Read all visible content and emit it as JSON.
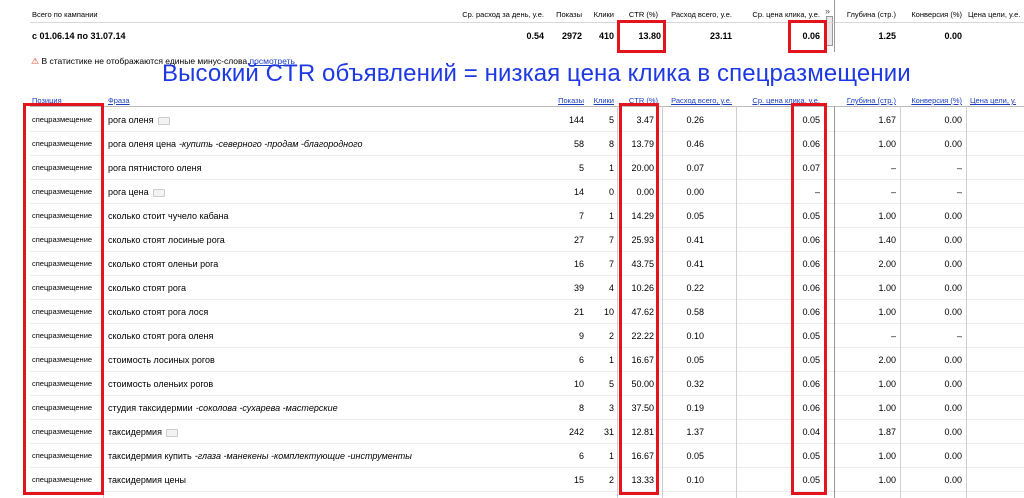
{
  "summary": {
    "label": "Всего по кампании",
    "period": "с 01.06.14 по 31.07.14",
    "headers": {
      "avg_daily": "Ср. расход за день, у.е.",
      "impressions": "Показы",
      "clicks": "Клики",
      "ctr": "CTR (%)",
      "total_cost": "Расход всего, у.е.",
      "avg_cpc": "Ср. цена клика, у.е.",
      "depth": "Глубина (стр.)",
      "conversion": "Конверсия (%)",
      "goal_cost": "Цена цели, у.е."
    },
    "values": {
      "avg_daily": "0.54",
      "impressions": "2972",
      "clicks": "410",
      "ctr": "13.80",
      "total_cost": "23.11",
      "avg_cpc": "0.06",
      "depth": "1.25",
      "conversion": "0.00"
    }
  },
  "warning": {
    "text": "В статистике не отображаются единые минус-слова",
    "link": "посмотреть"
  },
  "annotation": "Высокий CTR объявлений = низкая цена клика в спецразмещении",
  "table": {
    "headers": {
      "position": "Позиция",
      "phrase": "Фраза",
      "impressions": "Показы",
      "clicks": "Клики",
      "ctr": "CTR (%)",
      "total_cost": "Расход всего, у.е.",
      "avg_cpc": "Ср. цена клика, у.е.",
      "depth": "Глубина (стр.)",
      "conversion": "Конверсия (%)",
      "goal_cost": "Цена цели, у."
    },
    "rows": [
      {
        "position": "спецразмещение",
        "phrase": "рога оленя",
        "minus": "",
        "dots": true,
        "impressions": "144",
        "clicks": "5",
        "ctr": "3.47",
        "total_cost": "0.26",
        "avg_cpc": "0.05",
        "depth": "1.67",
        "conversion": "0.00"
      },
      {
        "position": "спецразмещение",
        "phrase": "рога оленя цена",
        "minus": "-купить -северного -продам -благородного",
        "dots": false,
        "impressions": "58",
        "clicks": "8",
        "ctr": "13.79",
        "total_cost": "0.46",
        "avg_cpc": "0.06",
        "depth": "1.00",
        "conversion": "0.00"
      },
      {
        "position": "спецразмещение",
        "phrase": "рога пятнистого оленя",
        "minus": "",
        "dots": false,
        "impressions": "5",
        "clicks": "1",
        "ctr": "20.00",
        "total_cost": "0.07",
        "avg_cpc": "0.07",
        "depth": "–",
        "conversion": "–"
      },
      {
        "position": "спецразмещение",
        "phrase": "рога цена",
        "minus": "",
        "dots": true,
        "impressions": "14",
        "clicks": "0",
        "ctr": "0.00",
        "total_cost": "0.00",
        "avg_cpc": "–",
        "depth": "–",
        "conversion": "–"
      },
      {
        "position": "спецразмещение",
        "phrase": "сколько стоит чучело кабана",
        "minus": "",
        "dots": false,
        "impressions": "7",
        "clicks": "1",
        "ctr": "14.29",
        "total_cost": "0.05",
        "avg_cpc": "0.05",
        "depth": "1.00",
        "conversion": "0.00"
      },
      {
        "position": "спецразмещение",
        "phrase": "сколько стоят лосиные рога",
        "minus": "",
        "dots": false,
        "impressions": "27",
        "clicks": "7",
        "ctr": "25.93",
        "total_cost": "0.41",
        "avg_cpc": "0.06",
        "depth": "1.40",
        "conversion": "0.00"
      },
      {
        "position": "спецразмещение",
        "phrase": "сколько стоят оленьи рога",
        "minus": "",
        "dots": false,
        "impressions": "16",
        "clicks": "7",
        "ctr": "43.75",
        "total_cost": "0.41",
        "avg_cpc": "0.06",
        "depth": "2.00",
        "conversion": "0.00"
      },
      {
        "position": "спецразмещение",
        "phrase": "сколько стоят рога",
        "minus": "",
        "dots": false,
        "impressions": "39",
        "clicks": "4",
        "ctr": "10.26",
        "total_cost": "0.22",
        "avg_cpc": "0.06",
        "depth": "1.00",
        "conversion": "0.00"
      },
      {
        "position": "спецразмещение",
        "phrase": "сколько стоят рога лося",
        "minus": "",
        "dots": false,
        "impressions": "21",
        "clicks": "10",
        "ctr": "47.62",
        "total_cost": "0.58",
        "avg_cpc": "0.06",
        "depth": "1.00",
        "conversion": "0.00"
      },
      {
        "position": "спецразмещение",
        "phrase": "сколько стоят рога оленя",
        "minus": "",
        "dots": false,
        "impressions": "9",
        "clicks": "2",
        "ctr": "22.22",
        "total_cost": "0.10",
        "avg_cpc": "0.05",
        "depth": "–",
        "conversion": "–"
      },
      {
        "position": "спецразмещение",
        "phrase": "стоимость лосиных рогов",
        "minus": "",
        "dots": false,
        "impressions": "6",
        "clicks": "1",
        "ctr": "16.67",
        "total_cost": "0.05",
        "avg_cpc": "0.05",
        "depth": "2.00",
        "conversion": "0.00"
      },
      {
        "position": "спецразмещение",
        "phrase": "стоимость оленьих рогов",
        "minus": "",
        "dots": false,
        "impressions": "10",
        "clicks": "5",
        "ctr": "50.00",
        "total_cost": "0.32",
        "avg_cpc": "0.06",
        "depth": "1.00",
        "conversion": "0.00"
      },
      {
        "position": "спецразмещение",
        "phrase": "студия таксидермии",
        "minus": "-соколова -сухарева -мастерские",
        "dots": false,
        "impressions": "8",
        "clicks": "3",
        "ctr": "37.50",
        "total_cost": "0.19",
        "avg_cpc": "0.06",
        "depth": "1.00",
        "conversion": "0.00"
      },
      {
        "position": "спецразмещение",
        "phrase": "таксидермия",
        "minus": "",
        "dots": true,
        "impressions": "242",
        "clicks": "31",
        "ctr": "12.81",
        "total_cost": "1.37",
        "avg_cpc": "0.04",
        "depth": "1.87",
        "conversion": "0.00"
      },
      {
        "position": "спецразмещение",
        "phrase": "таксидермия купить",
        "minus": "-глаза -манекены -комплектующие -инструменты",
        "dots": false,
        "impressions": "6",
        "clicks": "1",
        "ctr": "16.67",
        "total_cost": "0.05",
        "avg_cpc": "0.05",
        "depth": "1.00",
        "conversion": "0.00"
      },
      {
        "position": "спецразмещение",
        "phrase": "таксидермия цены",
        "minus": "",
        "dots": false,
        "impressions": "15",
        "clicks": "2",
        "ctr": "13.33",
        "total_cost": "0.10",
        "avg_cpc": "0.05",
        "depth": "1.00",
        "conversion": "0.00"
      }
    ]
  },
  "colors": {
    "highlight": "#e3141d",
    "annotation": "#1d39e3",
    "link": "#1a3dc1"
  }
}
